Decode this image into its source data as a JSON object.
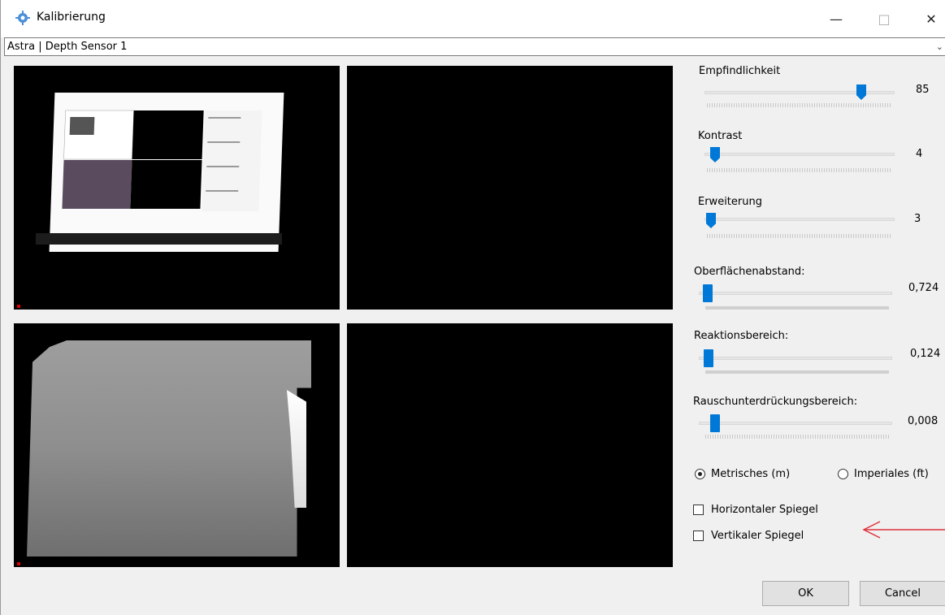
{
  "window": {
    "title": "Kalibrierung"
  },
  "sensor": {
    "selected": "Astra | Depth Sensor 1"
  },
  "sliders": [
    {
      "label": "Empfindlichkeit",
      "value": "85",
      "position": 0.85
    },
    {
      "label": "Kontrast",
      "value": "4",
      "position": 0.04
    },
    {
      "label": "Erweiterung",
      "value": "3",
      "position": 0.03
    },
    {
      "label": "Oberflächenabstand:",
      "value": "0,724",
      "position": 0.02
    },
    {
      "label": "Reaktionsbereich:",
      "value": "0,124",
      "position": 0.03
    },
    {
      "label": "Rauschunterdrückungsbereich:",
      "value": "0,008",
      "position": 0.06
    }
  ],
  "units": {
    "metric": "Metrisches (m)",
    "imperial": "Imperiales (ft)",
    "selected": "metric"
  },
  "mirror": {
    "horizontal": "Horizontaler Spiegel",
    "vertical": "Vertikaler Spiegel"
  },
  "buttons": {
    "ok": "OK",
    "cancel": "Cancel"
  },
  "colors": {
    "accent": "#0078d7",
    "annotation_arrow": "#e0303a"
  },
  "icons": [
    "gear-app-icon",
    "minimize-icon",
    "maximize-icon",
    "close-icon",
    "chevron-down-icon",
    "arrow-left-icon"
  ]
}
